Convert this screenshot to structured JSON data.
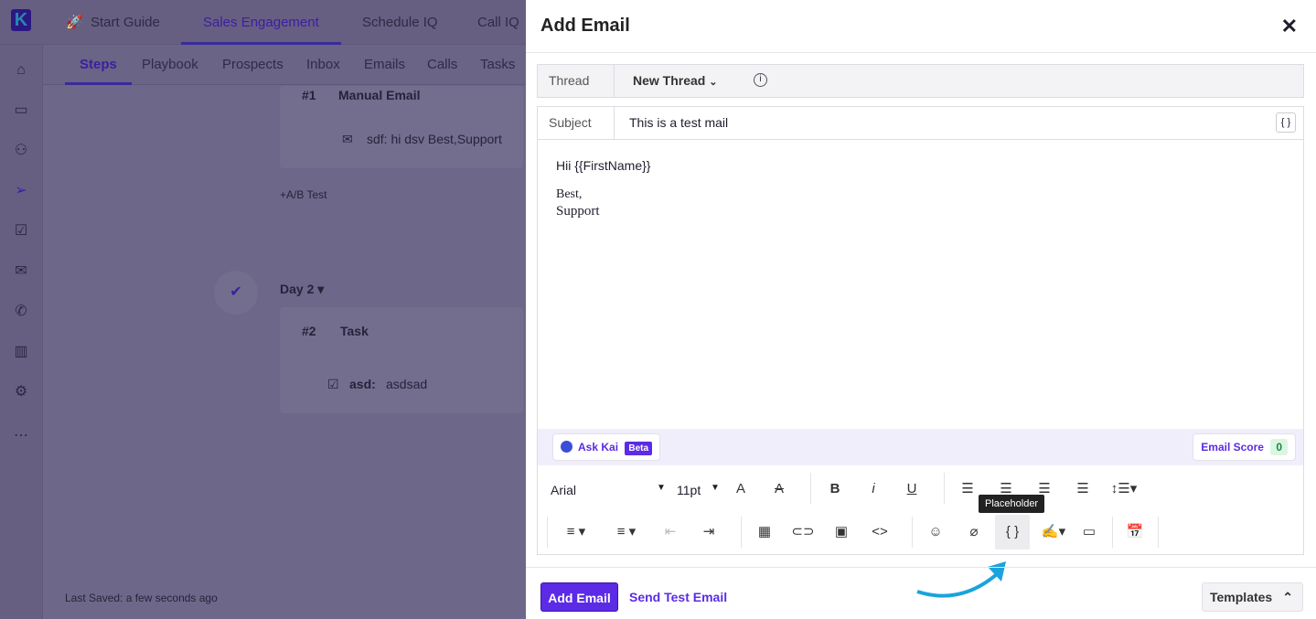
{
  "nav": {
    "top_tabs": [
      "Start Guide",
      "Sales Engagement",
      "Schedule IQ",
      "Call IQ"
    ],
    "sub_tabs": [
      "Steps",
      "Playbook",
      "Prospects",
      "Inbox",
      "Emails",
      "Calls",
      "Tasks"
    ]
  },
  "background": {
    "step1_num": "#1",
    "step1_type": "Manual Email",
    "step1_email": "sdf: hi dsv Best,Support",
    "ab_test": "+A/B Test",
    "day2": "Day 2",
    "step2_num": "#2",
    "step2_type": "Task",
    "step2_task_label": "asd:",
    "step2_task": "asdsad",
    "last_saved": "Last Saved: a few seconds ago"
  },
  "drawer": {
    "title": "Add Email",
    "thread_label": "Thread",
    "thread_value": "New Thread",
    "subject_label": "Subject",
    "subject_value": "This is a test mail",
    "body_line1": "Hii {{FirstName}}",
    "body_line2": "Best,",
    "body_line3": "Support",
    "ask_kai": "Ask Kai",
    "beta": "Beta",
    "email_score_label": "Email Score",
    "email_score": "0",
    "font": "Arial",
    "size": "11pt",
    "tooltip": "Placeholder",
    "add_email": "Add Email",
    "send_test": "Send Test Email",
    "templates": "Templates"
  }
}
